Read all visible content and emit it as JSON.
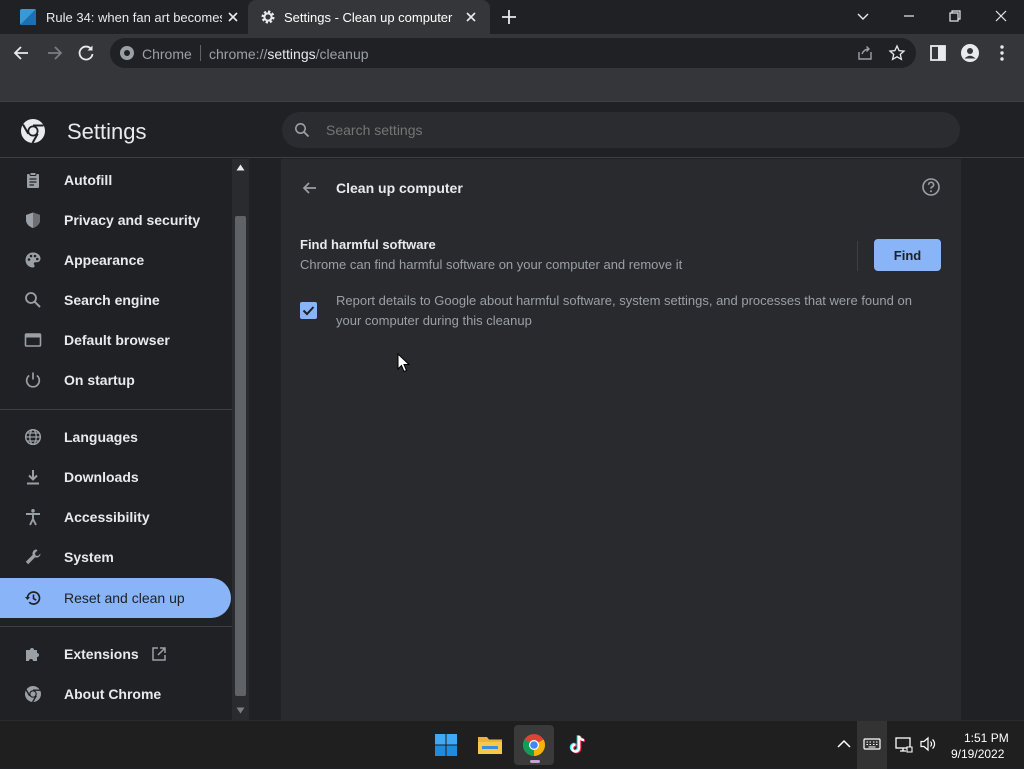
{
  "tabs": [
    {
      "title": "Rule 34: when fan art becomes d",
      "icon": "site-favicon"
    },
    {
      "title": "Settings - Clean up computer",
      "icon": "gear-icon"
    }
  ],
  "omnibox": {
    "scheme_label": "Chrome",
    "url_prefix": "chrome://",
    "url_host": "settings",
    "url_path": "/cleanup"
  },
  "settings": {
    "title": "Settings",
    "search_placeholder": "Search settings"
  },
  "sidebar": {
    "items": [
      {
        "label": "Autofill",
        "icon": "clipboard-icon"
      },
      {
        "label": "Privacy and security",
        "icon": "shield-icon"
      },
      {
        "label": "Appearance",
        "icon": "palette-icon"
      },
      {
        "label": "Search engine",
        "icon": "search-icon"
      },
      {
        "label": "Default browser",
        "icon": "browser-window-icon"
      },
      {
        "label": "On startup",
        "icon": "power-icon"
      },
      {
        "label": "Languages",
        "icon": "globe-icon"
      },
      {
        "label": "Downloads",
        "icon": "download-icon"
      },
      {
        "label": "Accessibility",
        "icon": "accessibility-icon"
      },
      {
        "label": "System",
        "icon": "wrench-icon"
      },
      {
        "label": "Reset and clean up",
        "icon": "history-icon",
        "active": true
      },
      {
        "label": "Extensions",
        "icon": "puzzle-icon"
      },
      {
        "label": "About Chrome",
        "icon": "chrome-icon"
      }
    ]
  },
  "cleanup": {
    "title": "Clean up computer",
    "find_title": "Find harmful software",
    "find_description": "Chrome can find harmful software on your computer and remove it",
    "find_button": "Find",
    "report_checked": true,
    "report_text": "Report details to Google about harmful software, system settings, and processes that were found on your computer during this cleanup"
  },
  "taskbar": {
    "apps": [
      "windows-start-icon",
      "file-explorer-icon",
      "chrome-icon",
      "tiktok-icon"
    ],
    "time": "1:51 PM",
    "date": "9/19/2022"
  },
  "colors": {
    "accent": "#8ab4f8",
    "background": "#202124",
    "card": "#292a2d",
    "toolbar": "#35363a"
  }
}
